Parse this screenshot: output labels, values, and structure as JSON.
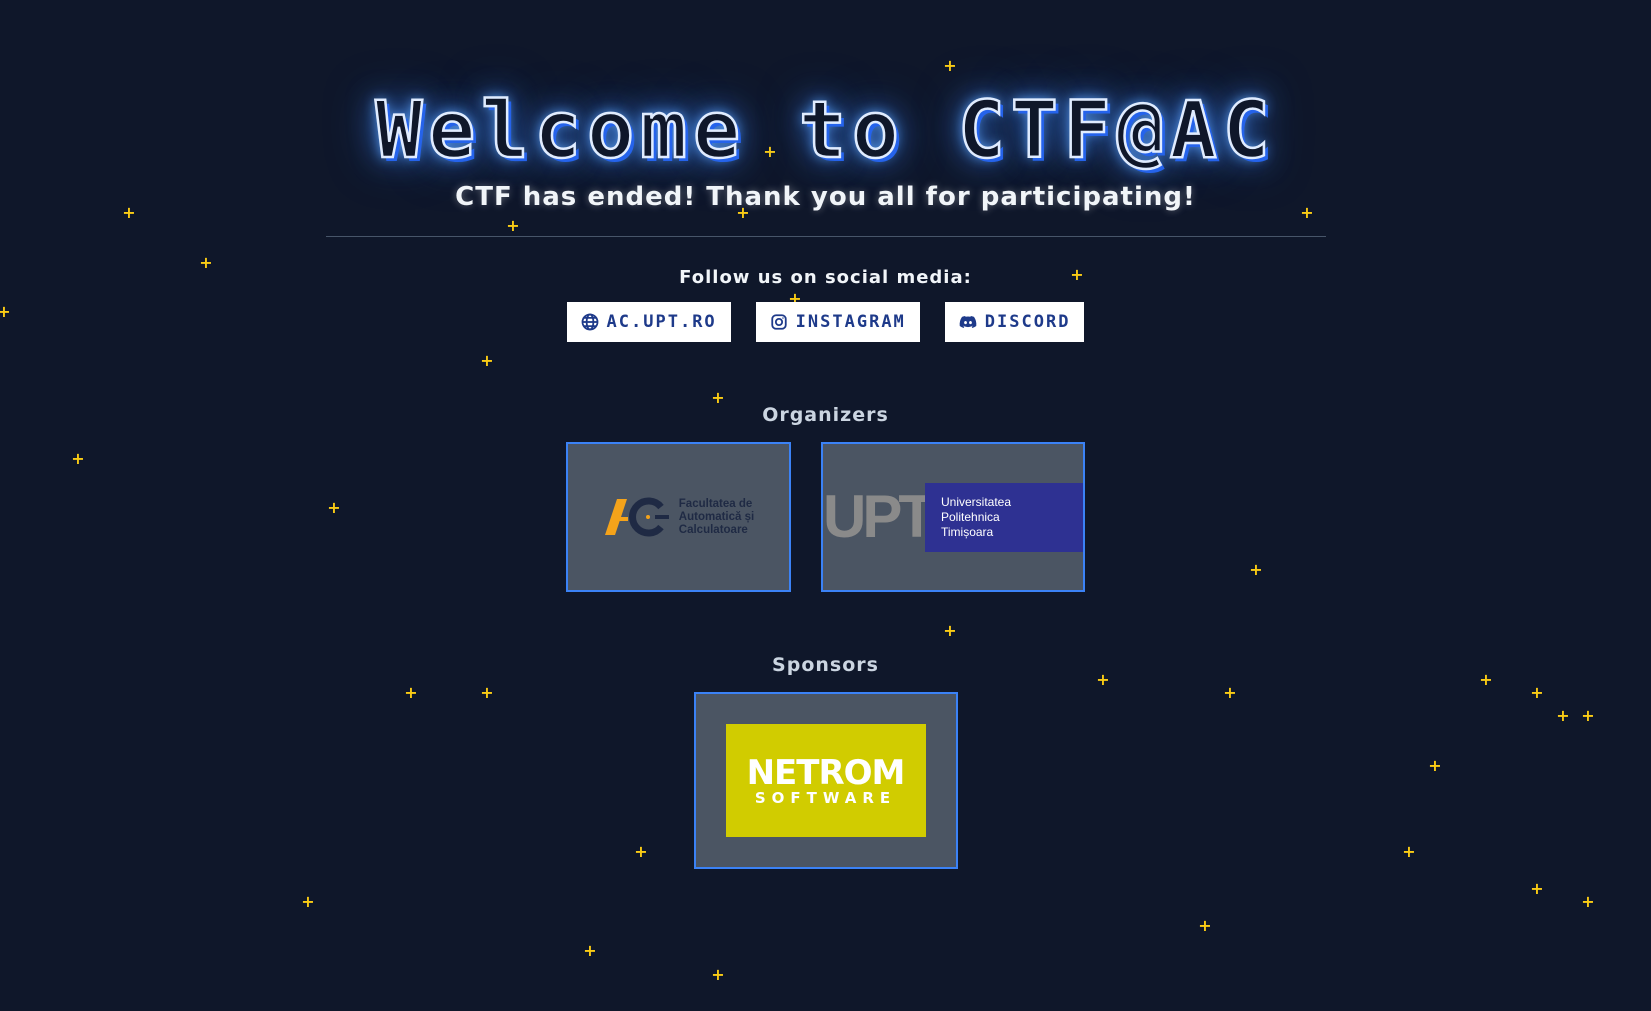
{
  "header": {
    "title": "Welcome to CTF@AC",
    "subtitle": "CTF has ended! Thank you all for participating!"
  },
  "social": {
    "heading": "Follow us on social media:",
    "links": [
      {
        "label": "ac.upt.ro",
        "icon": "globe-icon"
      },
      {
        "label": "Instagram",
        "icon": "instagram-icon"
      },
      {
        "label": "Discord",
        "icon": "discord-icon"
      }
    ]
  },
  "organizers": {
    "heading": "Organizers",
    "ac": {
      "logo_lines": [
        "Facultatea de",
        "Automatică și",
        "Calculatoare"
      ]
    },
    "upt": {
      "letters": "UPT",
      "logo_lines": [
        "Universitatea",
        "Politehnica",
        "Timișoara"
      ]
    }
  },
  "sponsors": {
    "heading": "Sponsors",
    "netrom": {
      "main": "NETROM",
      "sub": "SOFTWARE",
      "color": "#d1cc00"
    }
  },
  "colors": {
    "background": "#0f172a",
    "accent": "#3b82f6",
    "star": "#facc15",
    "card": "#4b5563"
  }
}
